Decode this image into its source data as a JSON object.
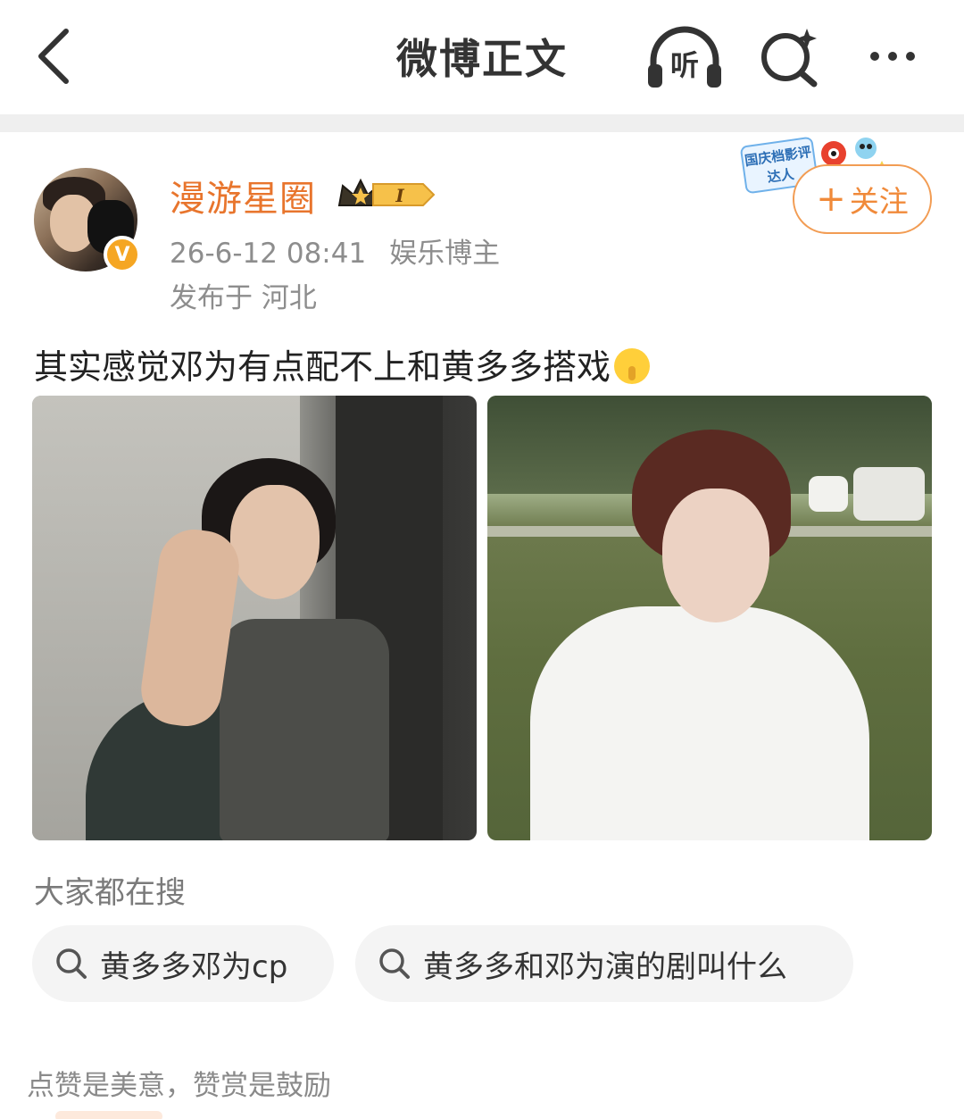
{
  "navbar": {
    "title": "微博正文",
    "listen_label": "听"
  },
  "post": {
    "author": {
      "name": "漫游星圈",
      "verified_mark": "V",
      "level_mark": "I"
    },
    "date": "26-6-12 08:41",
    "author_tag": "娱乐博主",
    "location": "发布于 河北",
    "activity_sticker": "国庆档影评达人",
    "follow_label": "关注",
    "text": "其实感觉邓为有点配不上和黄多多搭戏",
    "emoji": "shushing-face"
  },
  "trending": {
    "label": "大家都在搜",
    "chips": [
      {
        "text": "黄多多邓为cp"
      },
      {
        "text": "黄多多和邓为演的剧叫什么"
      }
    ]
  },
  "footer": {
    "hint": "点赞是美意，赞赏是鼓励"
  },
  "colors": {
    "username": "#e8752d",
    "follow_border": "#f29c53",
    "meta_text": "#8d8d8d",
    "chip_bg": "#f4f4f4"
  }
}
